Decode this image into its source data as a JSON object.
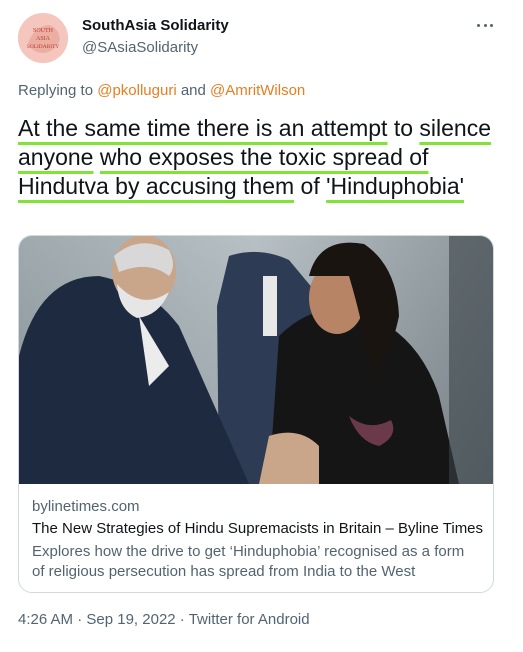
{
  "author": {
    "name": "SouthAsia Solidarity",
    "handle": "@SAsiaSolidarity",
    "avatar_icon": "solidarity-logo-icon",
    "avatar_text": [
      "SOUTH",
      "ASIA",
      "SOLIDARITY"
    ]
  },
  "more_icon": "more-dots-icon",
  "reply": {
    "prefix": "Replying to ",
    "mention1": "@pkolluguri",
    "joiner": " and ",
    "mention2": "@AmritWilson"
  },
  "tweet": {
    "segments": [
      {
        "text": "At the same time there is an attempt",
        "highlight": true
      },
      {
        "text": " to ",
        "highlight": false
      },
      {
        "text": "silence anyone",
        "highlight": true
      },
      {
        "text": " ",
        "highlight": false
      },
      {
        "text": "who exposes the toxic spread of Hindutva by accusing them",
        "highlight": true
      },
      {
        "text": " of ",
        "highlight": false
      },
      {
        "text": "'Hinduphobia'",
        "highlight": true
      }
    ]
  },
  "card": {
    "domain": "bylinetimes.com",
    "title": "The New Strategies of Hindu Supremacists in Britain – Byline Times",
    "description": "Explores how the drive to get ‘Hinduphobia’ recognised as a form of religious persecution has spread from India to the West"
  },
  "meta": {
    "time": "4:26 AM",
    "separator1": " · ",
    "date": "Sep 19, 2022",
    "separator2": " · ",
    "source": "Twitter for Android"
  },
  "colors": {
    "mention": "#e67e22",
    "highlight_underline": "#82e337",
    "secondary_text": "#536471"
  }
}
